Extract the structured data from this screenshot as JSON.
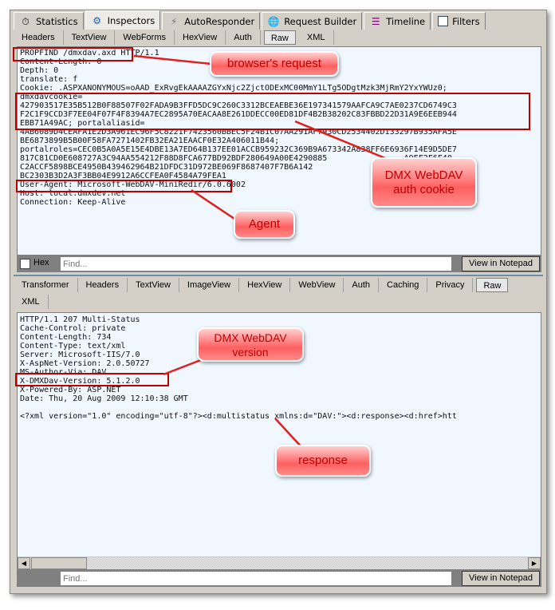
{
  "top_tabs": [
    {
      "label": "Statistics",
      "icon": "stopwatch-icon"
    },
    {
      "label": "Inspectors",
      "icon": "inspectors-icon",
      "active": true
    },
    {
      "label": "AutoResponder",
      "icon": "lightning-icon"
    },
    {
      "label": "Request Builder",
      "icon": "globe-hammer-icon"
    },
    {
      "label": "Timeline",
      "icon": "timeline-icon"
    },
    {
      "label": "Filters",
      "icon": "checkbox-icon"
    }
  ],
  "request": {
    "tabs": [
      "Headers",
      "TextView",
      "WebForms",
      "HexView",
      "Auth",
      "Raw",
      "XML"
    ],
    "active_tab": "Raw",
    "lines": [
      "PROPFIND /dmxdav.axd HTTP/1.1",
      "Content-Length: 0",
      "Depth: 0",
      "translate: f",
      "Cookie: .ASPXANONYMOUS=oAAD_ExRvgEkAAAAZGYxNjc2ZjctODExMC00MmY1LTg5ODgtMzk3MjRmY2YxYWUz0;",
      "dmxdavcookie=",
      "427903517E35B512B0F88507F02FADA9B3FFD5DC9C260C3312BCEAEBE36E197341579AAFCA9C7AE0237CD6749C3",
      "F2C1F9CCD3F7EE04F07F4F8394A7EC2895A70EACAA8E261DDECC00ED81DF4B2B38202C83FBBD22D31A9E6EEB944",
      "EBB71A49AC; portalaliasid=",
      "4AB6089D4CEAFA1E2D3A961EC96F5C8221F7423560BBEC5F24B1C07AA291AF7930CD2534402D133297B935AFA5E",
      "BE6873899B5B00F58FA7271402FB32EA21EAACF0E32A406011B44;",
      "portalroles=CEC0B5A0A5E15E4DBE13A7ED64B137EE01ACCB959232C369B9A673342A838FF6E6936F14E9D5DE7",
      "817C81CD0E608727A3C94AA554212F88D8FCA677BD92BDF280649A00E4290885                A9EF2F6F40",
      "C2ACCF5898BCE4950B439462964B21DFDC31D972BE069F8687407F7B6A142                  71A8440E4",
      "BC2303B3D2A3F3BB04E9912A6CCFEA0F4584A79FEA1",
      "User-Agent: Microsoft-WebDAV-MiniRedir/6.0.6002",
      "Host: local.dmxdev.net",
      "Connection: Keep-Alive"
    ],
    "hex_label": "Hex",
    "find_placeholder": "Find...",
    "notepad_label": "View in Notepad"
  },
  "response": {
    "tabs": [
      "Transformer",
      "Headers",
      "TextView",
      "ImageView",
      "HexView",
      "WebView",
      "Auth",
      "Caching",
      "Privacy",
      "Raw",
      "XML"
    ],
    "active_tab": "Raw",
    "lines": [
      "HTTP/1.1 207 Multi-Status",
      "Cache-Control: private",
      "Content-Length: 734",
      "Content-Type: text/xml",
      "Server: Microsoft-IIS/7.0",
      "X-AspNet-Version: 2.0.50727",
      "MS-Author-Via: DAV",
      "X-DMXDav-Version: 5.1.2.0",
      "X-Powered-By: ASP.NET",
      "Date: Thu, 20 Aug 2009 12:10:38 GMT",
      "",
      "<?xml version=\"1.0\" encoding=\"utf-8\"?><d:multistatus xmlns:d=\"DAV:\"><d:response><d:href>htt"
    ],
    "find_placeholder": "Find...",
    "notepad_label": "View in Notepad"
  },
  "annotations": {
    "browser_request": "browser's request",
    "auth_cookie_1": "DMX WebDAV",
    "auth_cookie_2": "auth cookie",
    "agent": "Agent",
    "version_1": "DMX WebDAV",
    "version_2": "version",
    "response": "response"
  },
  "colors": {
    "highlight": "#b00000",
    "callout": "#ff6060",
    "pane_bg": "#f0f7ff",
    "chrome": "#d4d0c8"
  }
}
